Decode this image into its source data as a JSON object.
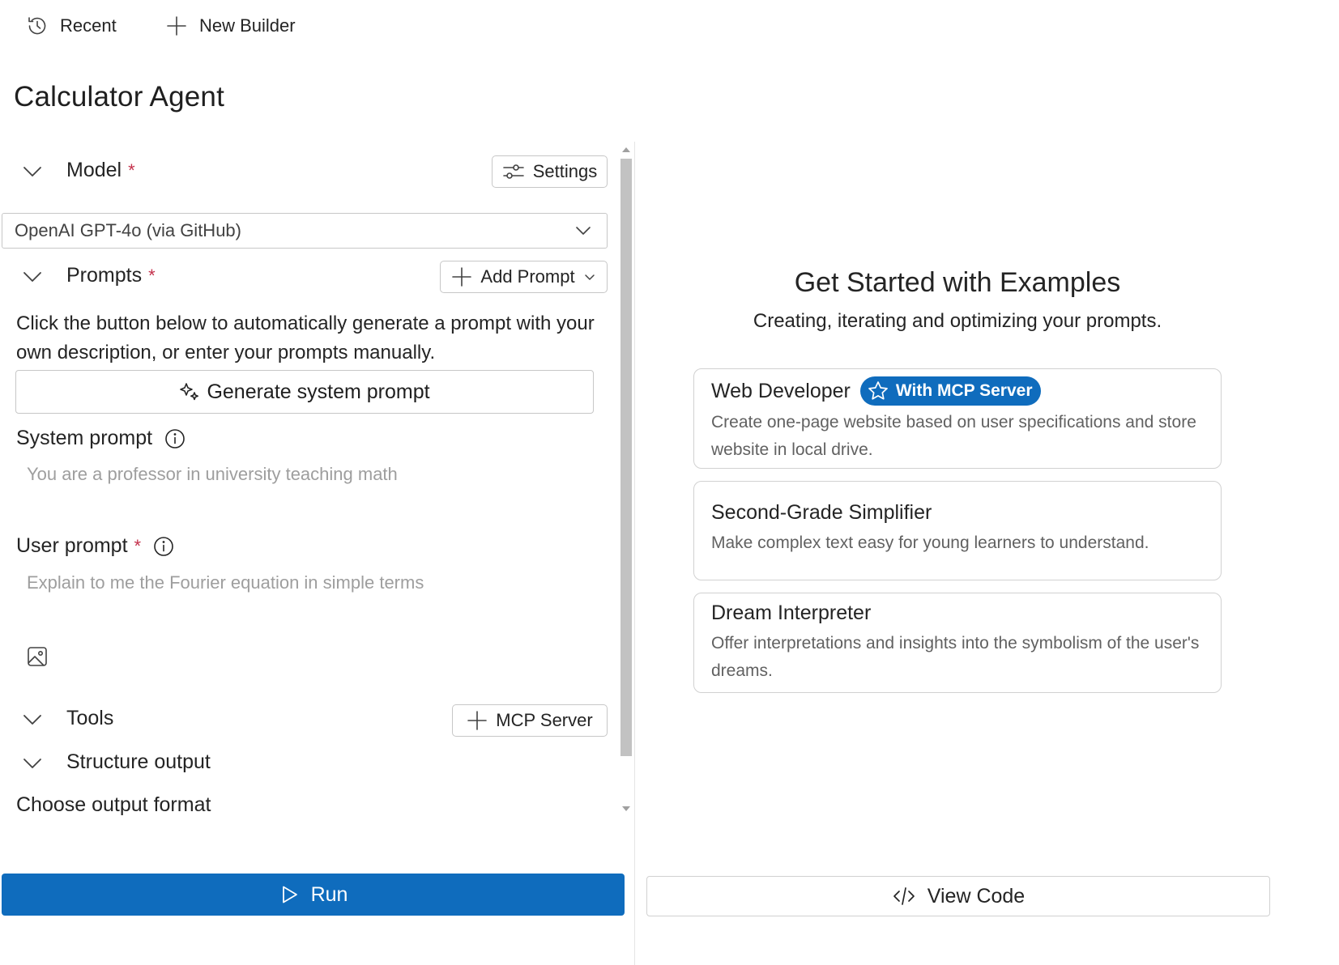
{
  "topbar": {
    "recent_label": "Recent",
    "new_builder_label": "New Builder"
  },
  "page": {
    "title": "Calculator Agent"
  },
  "model": {
    "label": "Model",
    "required_mark": "*",
    "settings_label": "Settings",
    "selected": "OpenAI GPT-4o (via GitHub)"
  },
  "prompts": {
    "label": "Prompts",
    "required_mark": "*",
    "add_prompt_label": "Add Prompt",
    "description": "Click the button below to automatically generate a prompt with your own description, or enter your prompts manually.",
    "generate_label": "Generate system prompt",
    "system_label": "System prompt",
    "system_placeholder": "You are a professor in university teaching math",
    "user_label": "User prompt",
    "user_required_mark": "*",
    "user_placeholder": "Explain to me the Fourier equation in simple terms"
  },
  "tools": {
    "label": "Tools",
    "mcp_label": "MCP Server"
  },
  "structure": {
    "label": "Structure output",
    "format_label": "Choose output format"
  },
  "actions": {
    "run_label": "Run",
    "view_code_label": "View Code"
  },
  "examples": {
    "title": "Get Started with Examples",
    "subtitle": "Creating, iterating and optimizing your prompts.",
    "cards": [
      {
        "title": "Web Developer",
        "badge": "With MCP Server",
        "description": "Create one-page website based on user specifications and store website in local drive."
      },
      {
        "title": "Second-Grade Simplifier",
        "description": "Make complex text easy for young learners to understand."
      },
      {
        "title": "Dream Interpreter",
        "description": "Offer interpretations and insights into the symbolism of the user's dreams."
      }
    ]
  },
  "colors": {
    "accent": "#0f6cbd",
    "required": "#c4314b",
    "border": "#c7c7c7",
    "placeholder": "#9e9e9e"
  }
}
